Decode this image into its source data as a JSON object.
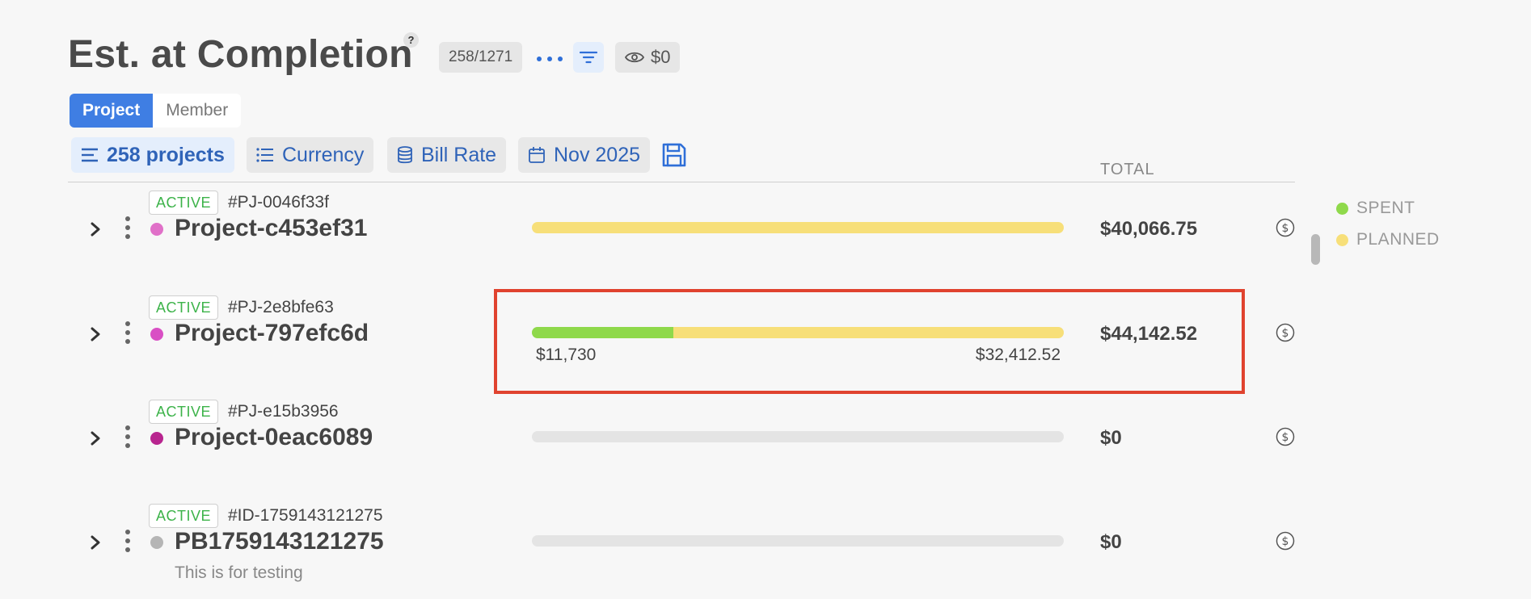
{
  "header": {
    "title": "Est. at Completion",
    "help_label": "?",
    "count_badge": "258/1271",
    "eye_value": "$0"
  },
  "view_toggle": {
    "project_label": "Project",
    "member_label": "Member"
  },
  "filters": {
    "projects_label": "258 projects",
    "currency_label": "Currency",
    "bill_rate_label": "Bill Rate",
    "date_label": "Nov 2025"
  },
  "table": {
    "total_header": "TOTAL"
  },
  "rows": [
    {
      "status": "ACTIVE",
      "code": "#PJ-0046f33f",
      "name": "Project-c453ef31",
      "dot_color": "#e070c8",
      "spent_fraction": 0,
      "planned": true,
      "spent_label": "",
      "planned_label": "",
      "total": "$40,066.75",
      "subtext": ""
    },
    {
      "status": "ACTIVE",
      "code": "#PJ-2e8bfe63",
      "name": "Project-797efc6d",
      "dot_color": "#d94fc4",
      "spent_fraction": 0.2657,
      "planned": true,
      "spent_label": "$11,730",
      "planned_label": "$32,412.52",
      "total": "$44,142.52",
      "subtext": ""
    },
    {
      "status": "ACTIVE",
      "code": "#PJ-e15b3956",
      "name": "Project-0eac6089",
      "dot_color": "#b8258f",
      "spent_fraction": 0,
      "planned": false,
      "spent_label": "",
      "planned_label": "",
      "total": "$0",
      "subtext": ""
    },
    {
      "status": "ACTIVE",
      "code": "#ID-1759143121275",
      "name": "PB1759143121275",
      "dot_color": "#b5b5b5",
      "spent_fraction": 0,
      "planned": false,
      "spent_label": "",
      "planned_label": "",
      "total": "$0",
      "subtext": "This is for testing"
    }
  ],
  "legend": {
    "spent_label": "SPENT",
    "spent_color": "#8fd94b",
    "planned_label": "PLANNED",
    "planned_color": "#f7df79"
  },
  "icons": [
    "help-icon",
    "more-icon",
    "filter-icon",
    "eye-icon",
    "list-icon",
    "bullet-list-icon",
    "database-icon",
    "calendar-icon",
    "save-icon",
    "chevron-right-icon",
    "kebab-icon",
    "dollar-circle-icon"
  ]
}
